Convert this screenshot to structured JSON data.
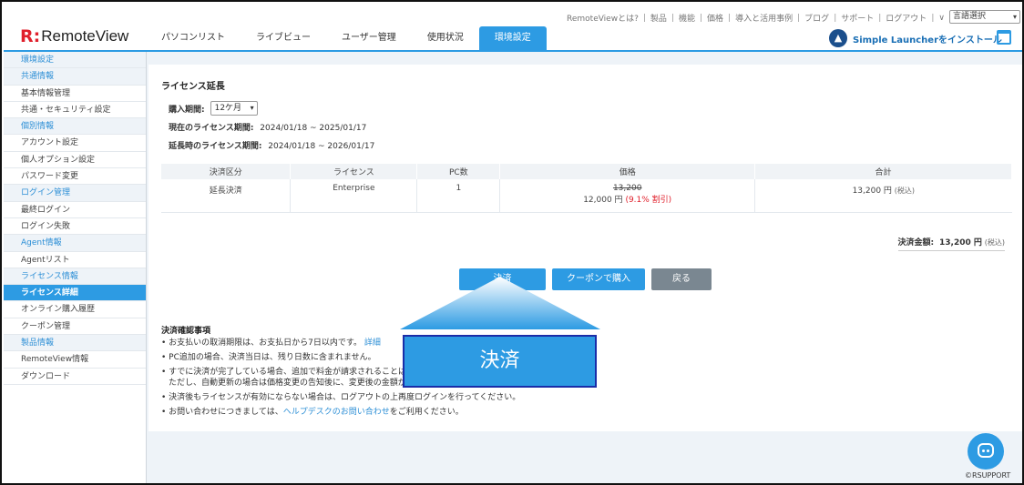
{
  "top_links": [
    "RemoteViewとは?",
    "製品",
    "機能",
    "価格",
    "導入と活用事例",
    "ブログ",
    "サポート",
    "ログアウト"
  ],
  "top_chevron": "∨",
  "language_select": "言語選択",
  "logo": {
    "mark": "R:",
    "text": "RemoteView"
  },
  "nav_tabs": [
    "パソコンリスト",
    "ライブビュー",
    "ユーザー管理",
    "使用状況",
    "環境設定"
  ],
  "launcher_label": "Simple Launcherをインストール",
  "sidebar": {
    "items": [
      {
        "label": "環境設定",
        "type": "cat"
      },
      {
        "label": "共通情報",
        "type": "cat"
      },
      {
        "label": "基本情報管理",
        "type": "sub"
      },
      {
        "label": "共通・セキュリティ設定",
        "type": "sub"
      },
      {
        "label": "個別情報",
        "type": "cat"
      },
      {
        "label": "アカウント設定",
        "type": "sub"
      },
      {
        "label": "個人オプション設定",
        "type": "sub"
      },
      {
        "label": "パスワード変更",
        "type": "sub"
      },
      {
        "label": "ログイン管理",
        "type": "cat"
      },
      {
        "label": "最終ログイン",
        "type": "sub"
      },
      {
        "label": "ログイン失敗",
        "type": "sub"
      },
      {
        "label": "Agent情報",
        "type": "cat"
      },
      {
        "label": "Agentリスト",
        "type": "sub"
      },
      {
        "label": "ライセンス情報",
        "type": "cat"
      },
      {
        "label": "ライセンス詳細",
        "type": "active"
      },
      {
        "label": "オンライン購入履歴",
        "type": "sub"
      },
      {
        "label": "クーポン管理",
        "type": "sub"
      },
      {
        "label": "製品情報",
        "type": "cat"
      },
      {
        "label": "RemoteView情報",
        "type": "sub"
      },
      {
        "label": "ダウンロード",
        "type": "sub"
      }
    ]
  },
  "page": {
    "title": "ライセンス延長",
    "period_label": "購入期間:",
    "period_value": "12ケ月",
    "current_label": "現在のライセンス期間:",
    "current_value": "2024/01/18 ~ 2025/01/17",
    "extended_label": "延長時のライセンス期間:",
    "extended_value": "2024/01/18 ~ 2026/01/17"
  },
  "table": {
    "headers": [
      "決済区分",
      "ライセンス",
      "PC数",
      "価格",
      "合計"
    ],
    "row": {
      "type": "延長決済",
      "license": "Enterprise",
      "pc_count": "1",
      "original_price": "13,200",
      "price": "12,000 円",
      "discount": "(9.1% 割引)",
      "total": "13,200 円",
      "tax": "(税込)"
    }
  },
  "total": {
    "label": "決済金額:",
    "amount": "13,200 円",
    "tax": "(税込)"
  },
  "buttons": {
    "pay": "決済",
    "coupon": "クーポンで購入",
    "back": "戻る"
  },
  "notes": {
    "title": "決済確認事項",
    "items": [
      {
        "text": "お支払いの取消期限は、お支払日から7日以内です。",
        "link": "詳細"
      },
      {
        "text": "PC追加の場合、決済当日は、残り日数に含まれません。"
      },
      {
        "text": "すでに決済が完了している場合、追加で料金が請求されることはありません。"
      },
      {
        "text": "ただし、自動更新の場合は価格変更の告知後に、変更後の金額が適用されます。"
      },
      {
        "text": "決済後もライセンスが有効にならない場合は、ログアウトの上再度ログインを行ってください。"
      },
      {
        "text": "お問い合わせにつきましては、",
        "link": "ヘルプデスクのお問い合わせ",
        "suffix": "をご利用ください。"
      }
    ]
  },
  "callout_label": "決済",
  "copyright": "©RSUPPORT",
  "colors": {
    "accent": "#2d9be3",
    "brand_red": "#e0202c",
    "callout_border": "#1a2da8"
  }
}
